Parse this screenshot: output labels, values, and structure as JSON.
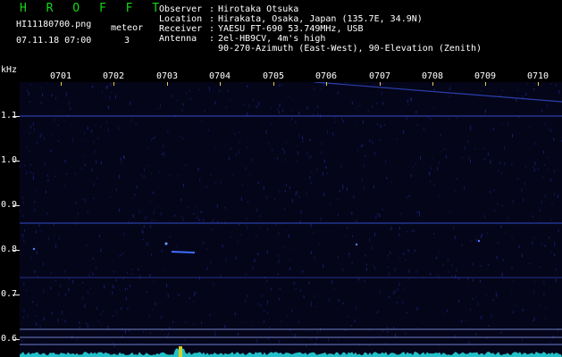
{
  "header": {
    "brand": "H R O F F T",
    "filename": "HI11180700.png",
    "meteor_label": "meteor",
    "meteor_count": "3",
    "datetime": "07.11.18 07:00"
  },
  "info": [
    {
      "key": "Observer",
      "value": "Hirotaka Otsuka"
    },
    {
      "key": "Location",
      "value": "Hirakata, Osaka, Japan (135.7E, 34.9N)"
    },
    {
      "key": "Receiver",
      "value": "YAESU FT-690 53.749MHz, USB"
    },
    {
      "key": "Antenna",
      "value": "2el-HB9CV, 4m's high"
    },
    {
      "key": "",
      "value": "90-270-Azimuth (East-West), 90-Elevation (Zenith)"
    }
  ],
  "axes": {
    "y_unit": "kHz",
    "y_ticks": [
      "1.1",
      "1.0",
      "0.9",
      "0.8",
      "0.7",
      "0.6"
    ],
    "x_ticks": [
      "0701",
      "0702",
      "0703",
      "0704",
      "0705",
      "0706",
      "0707",
      "0708",
      "0709",
      "0710"
    ]
  },
  "colors": {
    "background": "#000000",
    "brand": "#14d814",
    "tick": "#e8d24a",
    "line": "#2a3fa8",
    "spectrum": "#22c0c8"
  }
}
